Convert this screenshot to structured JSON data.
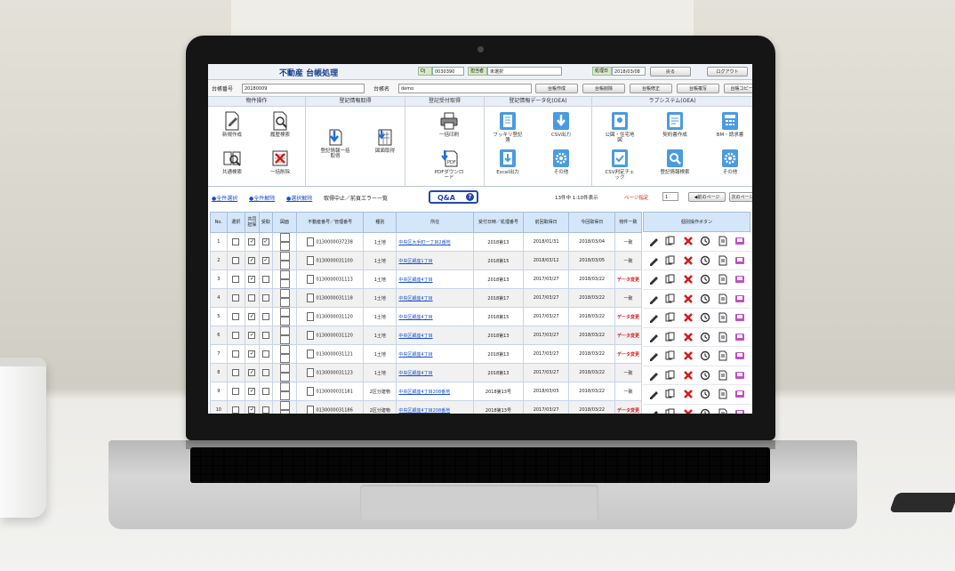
{
  "app": {
    "title": "不動産 台帳処理",
    "user_label": "担当者",
    "user_value": "未選択",
    "code_label": "Dj",
    "code_value": "0030390",
    "date_label": "処理日",
    "date_value": "2018/03/08",
    "top_buttons": [
      "戻る",
      "ログアウト"
    ]
  },
  "search": {
    "ledger_no_label": "台帳番号",
    "ledger_no_value": "20180009",
    "ledger_name_label": "台帳名",
    "ledger_name_value": "demo",
    "buttons": [
      "台帳作成",
      "台帳削除",
      "台帳修正",
      "台帳複写",
      "台帳コピー"
    ]
  },
  "panel": {
    "groups": [
      "物件操作",
      "登記情報取得",
      "登記受付取得",
      "登記情報データ化(OEA)",
      "ラブシステム(OEA)"
    ],
    "items": [
      {
        "label": "新規作成",
        "icon": "document-edit-icon"
      },
      {
        "label": "履歴検索",
        "icon": "document-search-icon"
      },
      {
        "label": "共通検索",
        "icon": "book-search-icon"
      },
      {
        "label": "一括削除",
        "icon": "delete-list-icon"
      },
      {
        "label": "登記情報一括取得",
        "icon": "download-doc-icon"
      },
      {
        "label": "図面取得",
        "icon": "map-download-icon"
      },
      {
        "label": "一括印刷",
        "icon": "printer-icon"
      },
      {
        "label": "PDFダウンロード",
        "icon": "pdf-download-icon"
      },
      {
        "label": "フッキリ登記簿",
        "icon": "ledger-icon"
      },
      {
        "label": "CSV出力",
        "icon": "csv-export-icon"
      },
      {
        "label": "Excel出力",
        "icon": "excel-export-icon"
      },
      {
        "label": "その他",
        "icon": "gear-icon"
      },
      {
        "label": "公図・住宅地図",
        "icon": "map-icon"
      },
      {
        "label": "契約書作成",
        "icon": "contract-icon"
      },
      {
        "label": "BM・請求書",
        "icon": "calculator-icon"
      },
      {
        "label": "CSV判定チェック",
        "icon": "csv-check-icon"
      },
      {
        "label": "登記情報検索",
        "icon": "search-doc-icon"
      },
      {
        "label": "その他",
        "icon": "gear-icon"
      }
    ]
  },
  "toolbar": {
    "links": [
      "●全件選択",
      "●全件解除",
      "●選択解除"
    ],
    "note": "取得中止／前頁エラー一覧",
    "qa_label": "Q&A",
    "paging": "13件中 1:10件表示",
    "page_label": "ページ指定",
    "page_value": "1",
    "prev_label": "◀前のページ",
    "next_label": "次のページ"
  },
  "table": {
    "headers": [
      "No.",
      "選択",
      "共同担保",
      "受取",
      "図面",
      "不動産番号／管理番号",
      "種別",
      "所在",
      "受付日時／処理番号",
      "前回取得日",
      "今回取得日",
      "物件一致"
    ],
    "actions_header": "個別操作ボタン",
    "rows": [
      {
        "no": "1",
        "sel": false,
        "share": true,
        "recv": true,
        "num": "0130000037238",
        "kind": "1土地",
        "loc": "中央区大手町一丁目2番地",
        "recno": "2018第13",
        "prev": "2018/01/31",
        "cur": "2018/03/04",
        "match": "一致",
        "red": false
      },
      {
        "no": "2",
        "sel": false,
        "share": true,
        "recv": true,
        "num": "0130000031100",
        "kind": "1土地",
        "loc": "中央区銀座1丁目",
        "recno": "2018第15",
        "prev": "2018/03/12",
        "cur": "2018/03/05",
        "match": "一致",
        "red": false
      },
      {
        "no": "3",
        "sel": false,
        "share": true,
        "recv": false,
        "num": "0130000031113",
        "kind": "1土地",
        "loc": "中央区銀座4丁目",
        "recno": "2018第13",
        "prev": "2017/03/27",
        "cur": "2018/03/22",
        "match": "データ変更",
        "red": true
      },
      {
        "no": "4",
        "sel": false,
        "share": false,
        "recv": false,
        "num": "0130000031118",
        "kind": "1土地",
        "loc": "中央区銀座4丁目",
        "recno": "2018第17",
        "prev": "2017/03/27",
        "cur": "2018/03/22",
        "match": "一致",
        "red": false
      },
      {
        "no": "5",
        "sel": false,
        "share": true,
        "recv": false,
        "num": "0130000031120",
        "kind": "1土地",
        "loc": "中央区銀座4丁目",
        "recno": "2018第15",
        "prev": "2017/03/27",
        "cur": "2018/03/22",
        "match": "データ変更",
        "red": true
      },
      {
        "no": "6",
        "sel": false,
        "share": true,
        "recv": false,
        "num": "0130000031120",
        "kind": "1土地",
        "loc": "中央区銀座4丁目",
        "recno": "2018第13",
        "prev": "2017/03/27",
        "cur": "2018/03/22",
        "match": "データ変更",
        "red": true
      },
      {
        "no": "7",
        "sel": false,
        "share": true,
        "recv": false,
        "num": "0130000031121",
        "kind": "1土地",
        "loc": "中央区銀座4丁目",
        "recno": "2018第13",
        "prev": "2017/03/27",
        "cur": "2018/03/22",
        "match": "データ変更",
        "red": true
      },
      {
        "no": "8",
        "sel": false,
        "share": true,
        "recv": false,
        "num": "0130000031123",
        "kind": "1土地",
        "loc": "中央区銀座4丁目",
        "recno": "2018第13",
        "prev": "2017/03/27",
        "cur": "2018/03/22",
        "match": "一致",
        "red": false
      },
      {
        "no": "9",
        "sel": false,
        "share": true,
        "recv": false,
        "num": "0130000031181",
        "kind": "2区分建物",
        "loc": "中央区銀座4丁目208番地",
        "recno": "2018第13号",
        "prev": "2018/03/05",
        "cur": "2018/03/22",
        "match": "一致",
        "red": false
      },
      {
        "no": "10",
        "sel": false,
        "share": true,
        "recv": false,
        "num": "0130000031186",
        "kind": "2区分建物",
        "loc": "中央区銀座4丁目208番地",
        "recno": "2018第13号",
        "prev": "2017/03/27",
        "cur": "2018/03/22",
        "match": "データ変更",
        "red": true
      }
    ],
    "row_actions": [
      "pencil-icon",
      "copy-icon",
      "delete-icon",
      "history-icon",
      "document-icon",
      "folder-icon"
    ]
  }
}
